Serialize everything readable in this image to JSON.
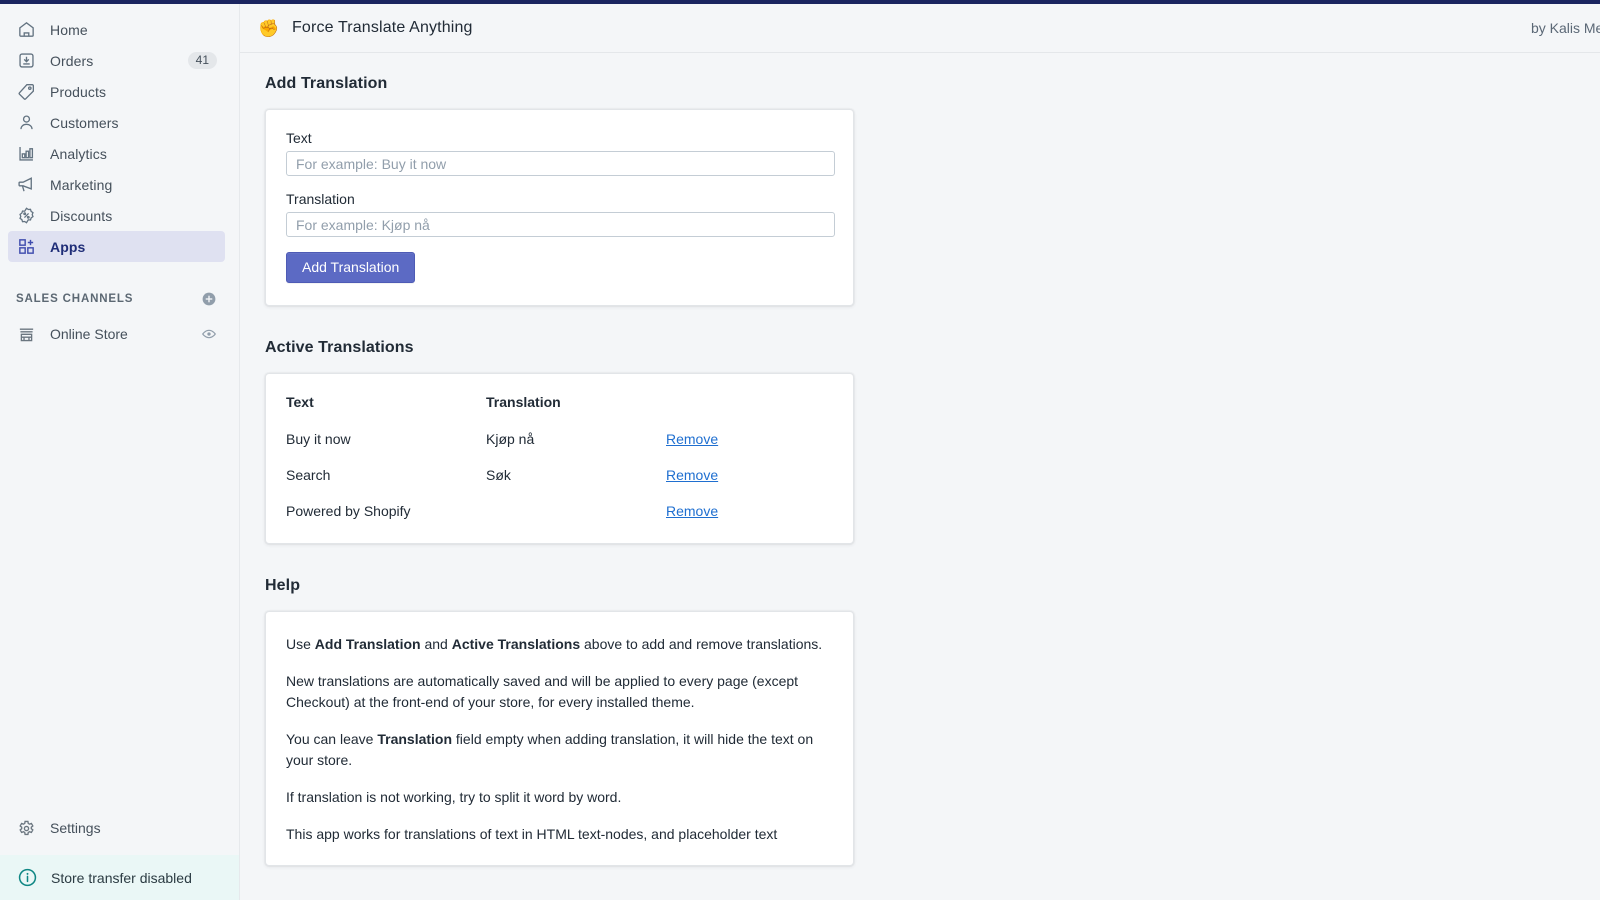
{
  "topbar": {
    "accent_color": "#1b2560"
  },
  "sidebar": {
    "nav": [
      {
        "label": "Home",
        "icon": "home-icon",
        "badge": ""
      },
      {
        "label": "Orders",
        "icon": "orders-icon",
        "badge": "41"
      },
      {
        "label": "Products",
        "icon": "products-tag-icon",
        "badge": ""
      },
      {
        "label": "Customers",
        "icon": "customers-person-icon",
        "badge": ""
      },
      {
        "label": "Analytics",
        "icon": "analytics-bar-chart-icon",
        "badge": ""
      },
      {
        "label": "Marketing",
        "icon": "marketing-megaphone-icon",
        "badge": ""
      },
      {
        "label": "Discounts",
        "icon": "discounts-percent-icon",
        "badge": ""
      },
      {
        "label": "Apps",
        "icon": "apps-grid-icon",
        "badge": ""
      }
    ],
    "active_nav": "Apps",
    "sales_channels": {
      "title": "SALES CHANNELS",
      "add_icon": "plus-circle-icon",
      "items": [
        {
          "label": "Online Store",
          "icon": "store-icon",
          "action_icon": "eye-icon"
        }
      ]
    },
    "settings": {
      "label": "Settings",
      "icon": "gear-icon"
    },
    "transfer_banner": {
      "label": "Store transfer disabled",
      "icon": "info-circle-icon",
      "background": "#eaf7f6",
      "icon_color": "#0f8784"
    }
  },
  "app_header": {
    "icon": "fist-hand-emoji",
    "title": "Force Translate Anything",
    "by_line": "by Kalis Media"
  },
  "add_translation": {
    "heading": "Add Translation",
    "text_label": "Text",
    "text_placeholder": "For example: Buy it now",
    "text_value": "",
    "translation_label": "Translation",
    "translation_placeholder": "For example: Kjøp nå",
    "translation_value": "",
    "submit_label": "Add Translation",
    "submit_color": "#5c6ac4"
  },
  "active_translations": {
    "heading": "Active Translations",
    "columns": [
      "Text",
      "Translation",
      ""
    ],
    "rows": [
      {
        "text": "Buy it now",
        "translation": "Kjøp nå",
        "action": "Remove"
      },
      {
        "text": "Search",
        "translation": "Søk",
        "action": "Remove"
      },
      {
        "text": "Powered by Shopify",
        "translation": "",
        "action": "Remove"
      }
    ],
    "link_color": "#1f6fd0"
  },
  "help": {
    "heading": "Help",
    "paragraphs": [
      {
        "segments": [
          {
            "t": "Use ",
            "b": false
          },
          {
            "t": "Add Translation",
            "b": true
          },
          {
            "t": " and ",
            "b": false
          },
          {
            "t": "Active Translations",
            "b": true
          },
          {
            "t": " above to add and remove translations.",
            "b": false
          }
        ]
      },
      {
        "segments": [
          {
            "t": "New translations are automatically saved and will be applied to every page (except Checkout) at the front-end of your store, for every installed theme.",
            "b": false
          }
        ]
      },
      {
        "segments": [
          {
            "t": "You can leave ",
            "b": false
          },
          {
            "t": "Translation",
            "b": true
          },
          {
            "t": " field empty when adding translation, it will hide the text on your store.",
            "b": false
          }
        ]
      },
      {
        "segments": [
          {
            "t": "If translation is not working, try to split it word by word.",
            "b": false
          }
        ]
      },
      {
        "segments": [
          {
            "t": "This app works for translations of text in HTML text-nodes, and placeholder text",
            "b": false
          }
        ]
      }
    ]
  }
}
